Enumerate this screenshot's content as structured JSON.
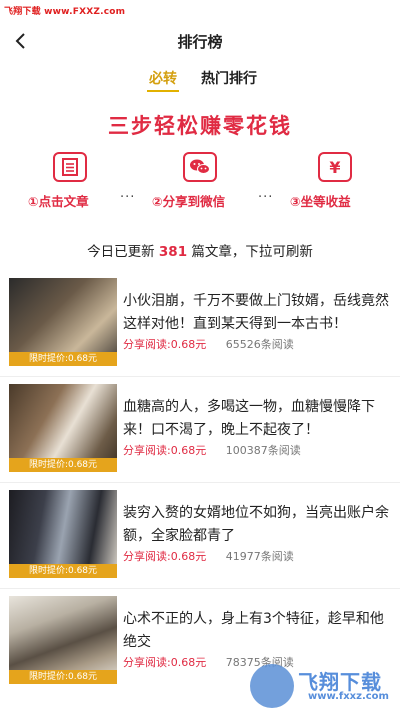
{
  "watermark_top": "飞翔下载 www.FXXZ.com",
  "header": {
    "title": "排行榜"
  },
  "tabs": [
    {
      "label": "必转",
      "active": true
    },
    {
      "label": "热门排行",
      "active": false
    }
  ],
  "slogan": "三步轻松赚零花钱",
  "steps": [
    {
      "icon": "article-icon",
      "label": "①点击文章"
    },
    {
      "icon": "wechat-icon",
      "label": "②分享到微信"
    },
    {
      "icon": "yuan-icon",
      "label": "③坐等收益"
    }
  ],
  "step_separator": "···",
  "update": {
    "prefix": "今日已更新",
    "count": "381",
    "suffix": "篇文章，下拉可刷新"
  },
  "articles": [
    {
      "title": "小伙泪崩，千万不要做上门钕婿，岳线竟然这样对他！直到某天得到一本古书！",
      "price_tag": "限时提价:0.68元",
      "share": "分享阅读:0.68元",
      "reads": "65526条阅读"
    },
    {
      "title": "血糖高的人，多喝这一物，血糖慢慢降下来！口不渴了，晚上不起夜了！",
      "price_tag": "限时提价:0.68元",
      "share": "分享阅读:0.68元",
      "reads": "100387条阅读"
    },
    {
      "title": "装穷入赘的女婿地位不如狗，当亮出账户余额，全家脸都青了",
      "price_tag": "限时提价:0.68元",
      "share": "分享阅读:0.68元",
      "reads": "41977条阅读"
    },
    {
      "title": "心术不正的人，身上有3个特征，趁早和他绝交",
      "price_tag": "限时提价:0.68元",
      "share": "分享阅读:0.68元",
      "reads": "78375条阅读"
    }
  ],
  "logo_watermark": {
    "main": "飞翔下载",
    "sub": "www.fxxz.com"
  },
  "colors": {
    "accent_red": "#e02b43",
    "accent_gold": "#e2b100",
    "price_tag": "#e5a41c"
  }
}
